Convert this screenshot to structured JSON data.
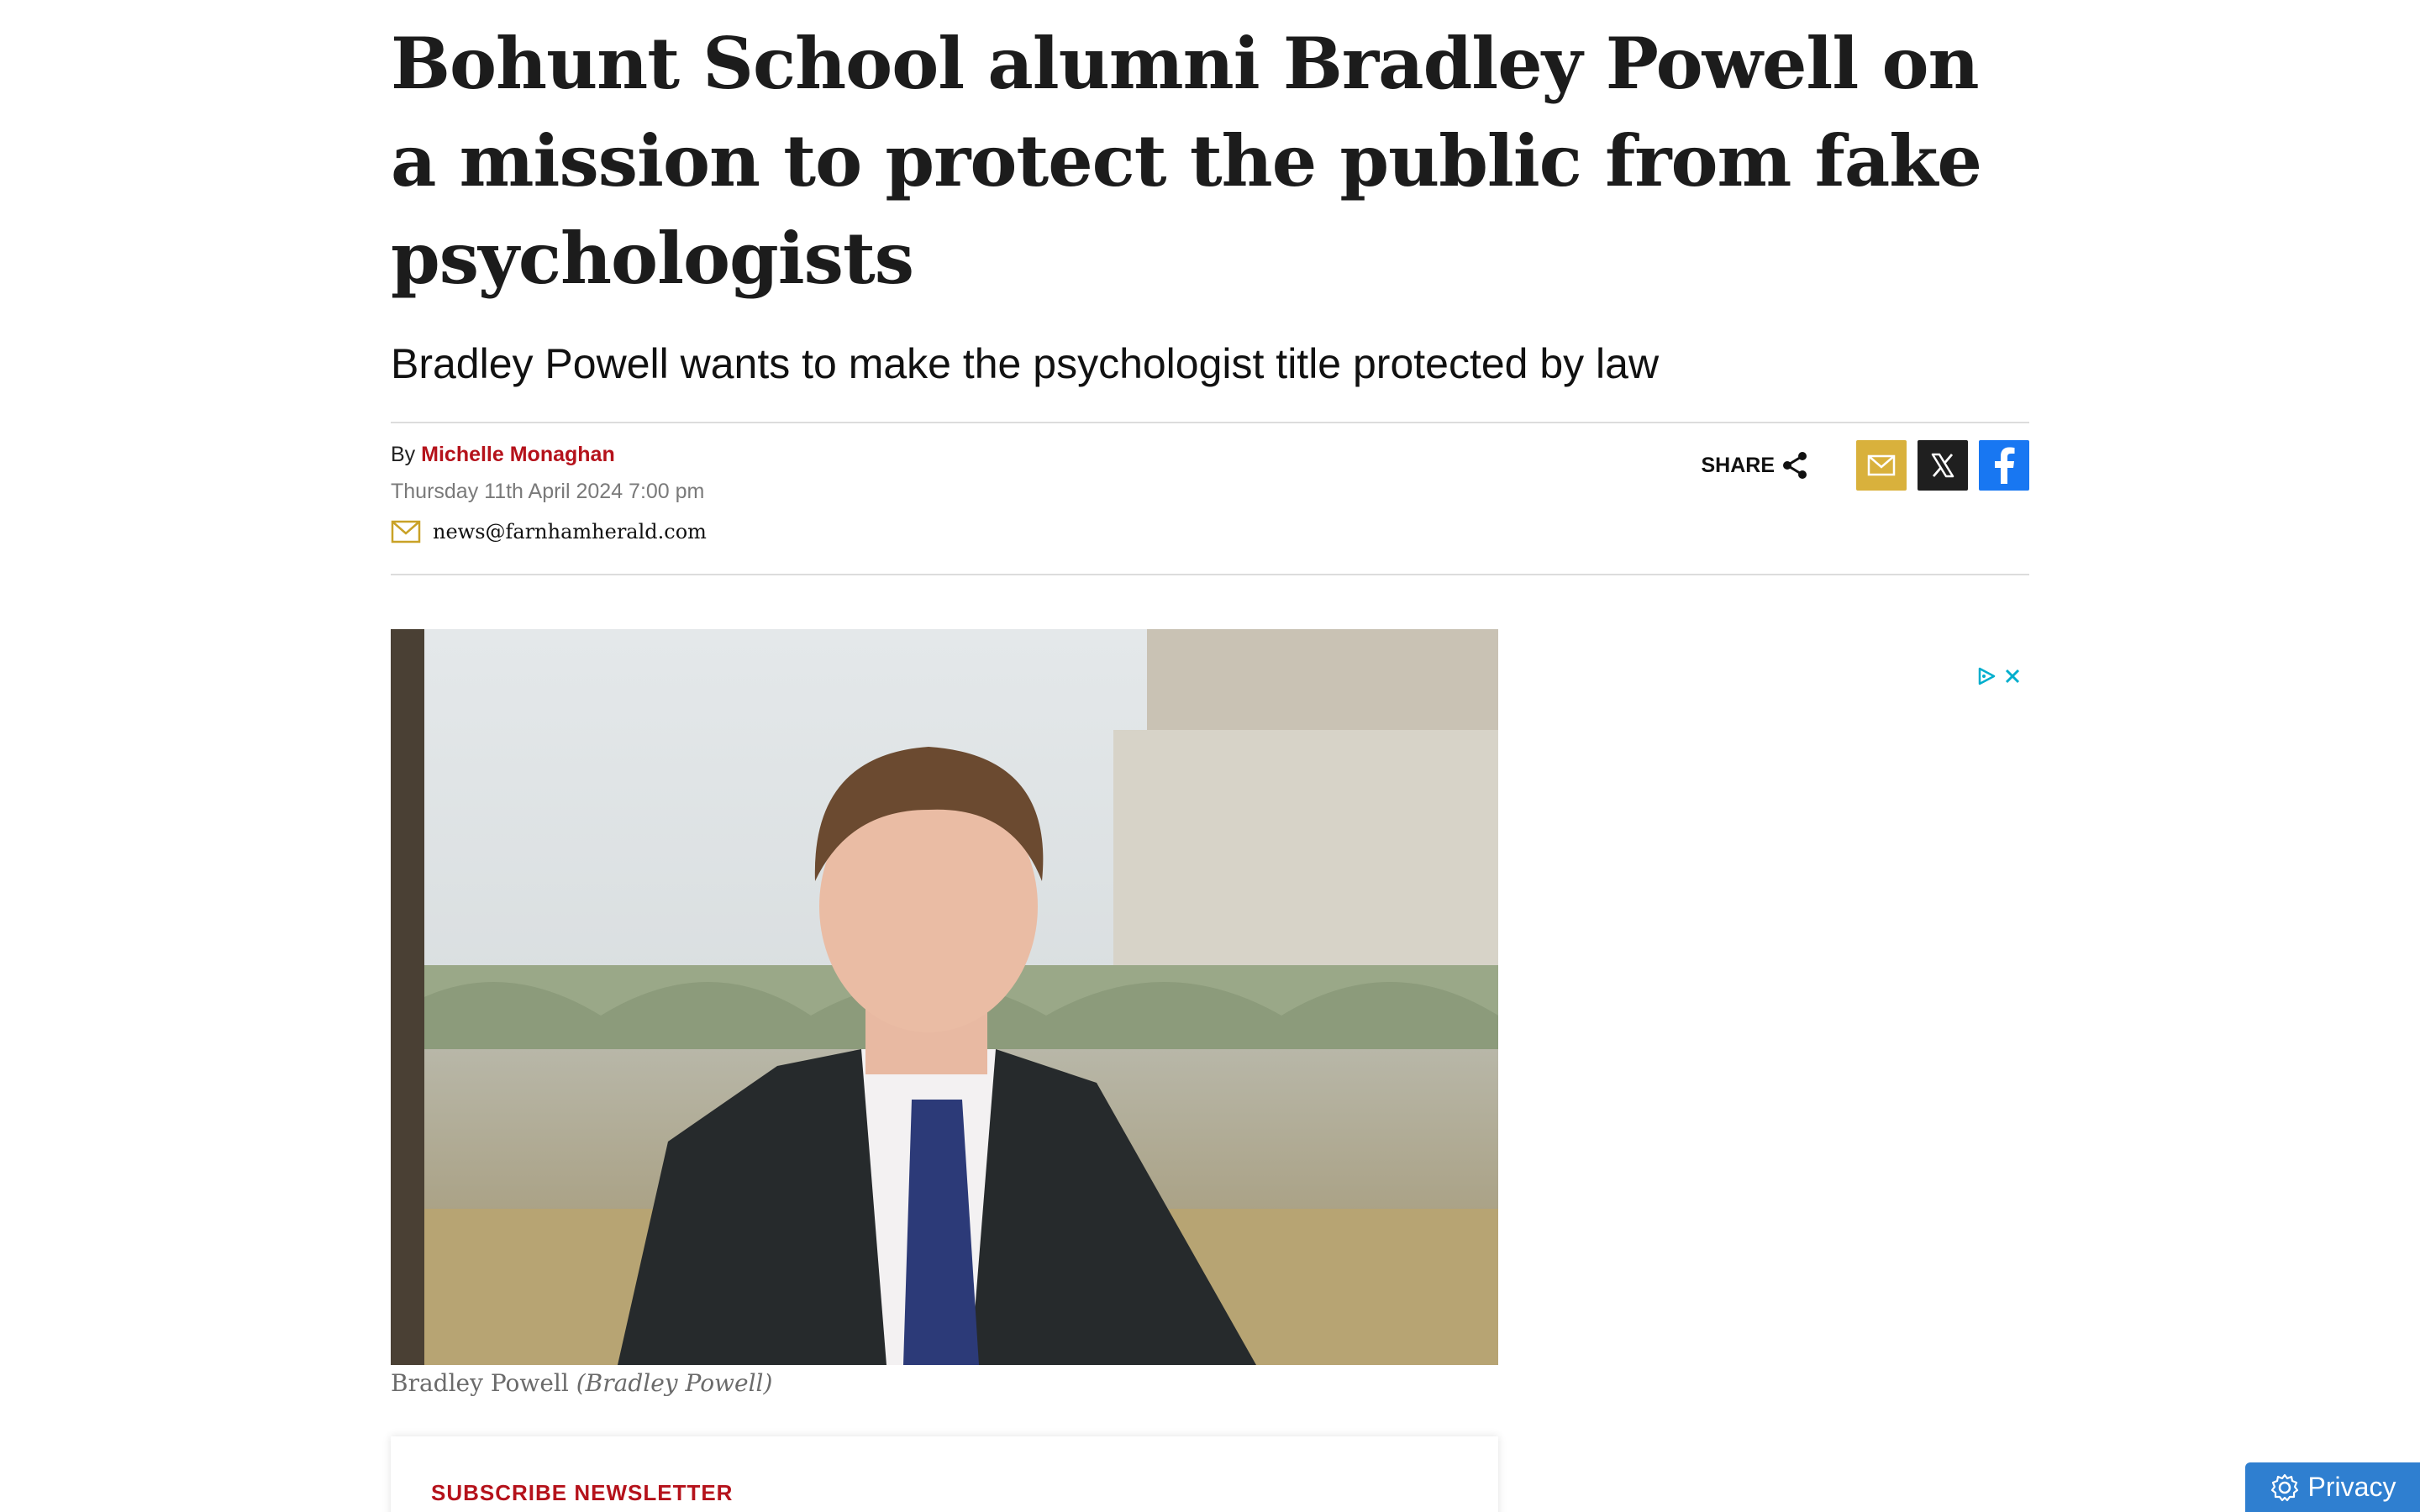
{
  "article": {
    "headline": "Bohunt School alumni Bradley Powell on a mission to protect the public from fake psychologists",
    "subheadline": "Bradley Powell wants to make the psychologist title protected by law",
    "byline_prefix": "By",
    "author": "Michelle Monaghan",
    "date": "Thursday 11th April 2024 7:00 pm",
    "contact_email": "news@farnhamherald.com"
  },
  "share": {
    "label": "SHARE",
    "buttons": [
      {
        "name": "email",
        "icon": "mail-icon",
        "color": "#d9b13c"
      },
      {
        "name": "x",
        "icon": "x-logo-icon",
        "color": "#1f1f1f"
      },
      {
        "name": "facebook",
        "icon": "facebook-icon",
        "color": "#1877f2"
      }
    ]
  },
  "photo": {
    "caption": "Bradley Powell",
    "credit": "(Bradley Powell)"
  },
  "newsletter": {
    "title": "SUBSCRIBE NEWSLETTER"
  },
  "privacy_button": {
    "label": "Privacy",
    "color": "#2f7fd0"
  },
  "colors": {
    "accent_red": "#b5121b",
    "ad_choices": "#00aecd"
  }
}
